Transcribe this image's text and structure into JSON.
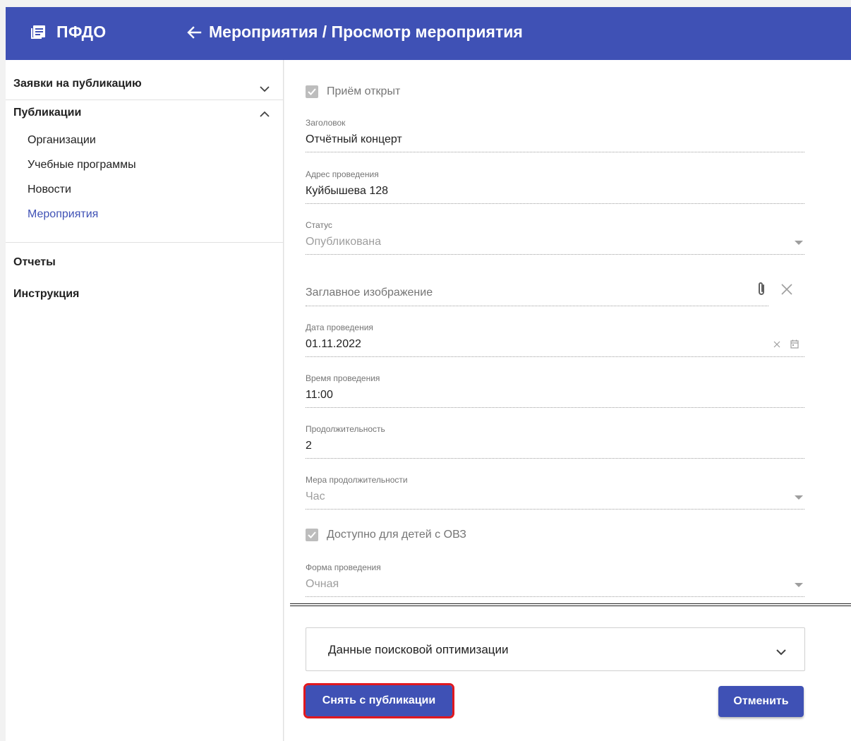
{
  "header": {
    "logo_text": "ПФДО",
    "title": "Мероприятия / Просмотр мероприятия",
    "color": "#3f51b5"
  },
  "sidebar": {
    "group_requests": "Заявки на публикацию",
    "group_publications": "Публикации",
    "items": [
      {
        "label": "Организации",
        "active": false
      },
      {
        "label": "Учебные программы",
        "active": false
      },
      {
        "label": "Новости",
        "active": false
      },
      {
        "label": "Мероприятия",
        "active": true
      }
    ],
    "reports": "Отчеты",
    "instructions": "Инструкция"
  },
  "form": {
    "reception_open": {
      "label": "Приём открыт",
      "checked": true
    },
    "title": {
      "label": "Заголовок",
      "value": "Отчётный концерт"
    },
    "address": {
      "label": "Адрес проведения",
      "value": "Куйбышева 128"
    },
    "status": {
      "label": "Статус",
      "value": "Опубликована"
    },
    "image": {
      "placeholder": "Заглавное изображение"
    },
    "date": {
      "label": "Дата проведения",
      "value": "01.11.2022"
    },
    "time": {
      "label": "Время проведения",
      "value": "11:00"
    },
    "duration": {
      "label": "Продолжительность",
      "value": "2"
    },
    "duration_unit": {
      "label": "Мера продолжительности",
      "value": "Час"
    },
    "disabled_children": {
      "label": "Доступно для детей с ОВЗ",
      "checked": true
    },
    "form_type": {
      "label": "Форма проведения",
      "value": "Очная"
    }
  },
  "seo": {
    "label": "Данные поисковой оптимизации"
  },
  "buttons": {
    "unpublish": "Снять с публикации",
    "cancel": "Отменить"
  }
}
